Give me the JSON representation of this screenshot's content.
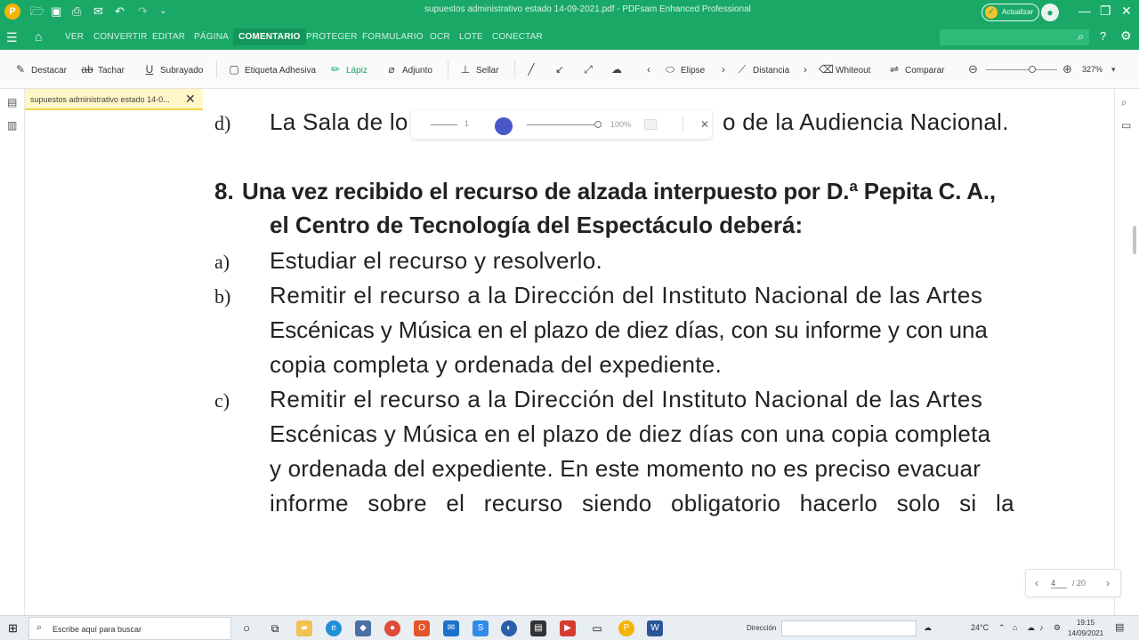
{
  "titlebar": {
    "logo": "P",
    "doc_title": "supuestos administrativo estado 14-09-2021.pdf  -  PDFsam Enhanced Professional",
    "update_label": "Actualizar"
  },
  "menubar": {
    "items": [
      "VER",
      "CONVERTIR",
      "EDITAR",
      "PÁGINA",
      "COMENTARIO",
      "PROTEGER",
      "FORMULARIO",
      "OCR",
      "LOTE",
      "CONECTAR"
    ],
    "active": "COMENTARIO"
  },
  "toolbar": {
    "destacar": "Destacar",
    "tachar": "Tachar",
    "subrayado": "Subrayado",
    "etiqueta": "Etiqueta Adhesiva",
    "lapiz": "Lápiz",
    "adjunto": "Adjunto",
    "sellar": "Sellar",
    "elipse": "Elipse",
    "distancia": "Distancia",
    "whiteout": "Whiteout",
    "comparar": "Comparar",
    "zoom": "327%"
  },
  "doc_tab": {
    "label": "supuestos administrativo estado 14-0..."
  },
  "pen_bar": {
    "width": "1",
    "opacity": "100%",
    "color": "#4a57c7"
  },
  "document": {
    "d_label": "d)",
    "d_text_left": "La Sala de lo",
    "d_text_right": "o de la Audiencia Nacional.",
    "q_num": "8.",
    "q_line1": "Una vez recibido el recurso de alzada interpuesto por D.ª Pepita C. A.,",
    "q_line2": "el Centro de Tecnología del Espectáculo deberá:",
    "a_label": "a)",
    "a_text": "Estudiar el recurso y resolverlo.",
    "b_label": "b)",
    "b_line1": "Remitir el recurso a la Dirección del Instituto Nacional de las Artes",
    "b_line2": "Escénicas y Música en el plazo de diez días, con su informe y con una",
    "b_line3": "copia completa y ordenada del expediente.",
    "c_label": "c)",
    "c_line1": "Remitir el recurso a la Dirección del Instituto Nacional de las Artes",
    "c_line2": "Escénicas y Música en el plazo de diez días con una copia completa",
    "c_line3": "y ordenada del expediente. En este momento no es preciso evacuar",
    "c_line4": "informe sobre el recurso siendo obligatorio hacerlo solo si la"
  },
  "page_nav": {
    "current": "4",
    "total": "/ 20"
  },
  "taskbar": {
    "search_placeholder": "Escribe aquí para buscar",
    "address_label": "Dirección",
    "temperature": "24°C",
    "time": "19:15",
    "date": "14/09/2021"
  }
}
